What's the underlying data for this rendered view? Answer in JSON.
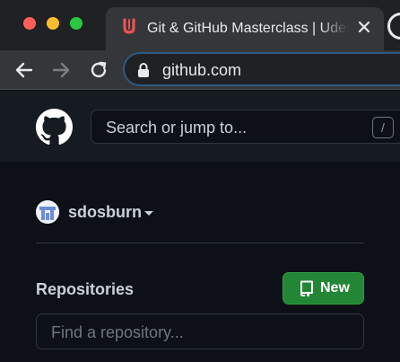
{
  "browser": {
    "tab": {
      "title": "Git & GitHub Masterclass | Udemy",
      "favicon": "udemy-logo-icon",
      "close_icon": "close-icon"
    },
    "next_tab_icon": "github-logo-icon",
    "window_controls": {
      "close_color": "#ff5f57",
      "minimize_color": "#febc2e",
      "maximize_color": "#28c840"
    },
    "toolbar": {
      "back_icon": "arrow-left-icon",
      "forward_icon": "arrow-right-icon",
      "reload_icon": "reload-icon",
      "lock_icon": "lock-icon",
      "url": "github.com"
    }
  },
  "github": {
    "header": {
      "logo_icon": "github-logo-icon",
      "search_placeholder": "Search or jump to...",
      "search_shortcut": "/"
    },
    "dashboard": {
      "username": "sdosburn",
      "user_menu_icon": "caret-down-icon",
      "repositories_title": "Repositories",
      "new_button_label": "New",
      "new_button_icon": "repo-icon",
      "find_repo_placeholder": "Find a repository..."
    }
  },
  "colors": {
    "page_bg": "#0d1117",
    "header_bg": "#161b22",
    "new_button_bg": "#238636",
    "udemy_accent": "#a435f0"
  }
}
